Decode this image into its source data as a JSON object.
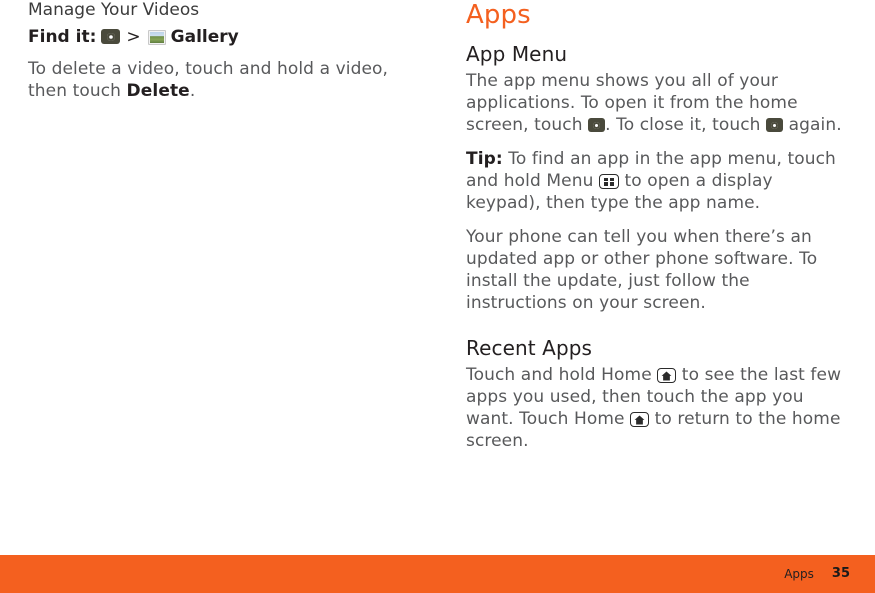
{
  "footer": {
    "section_label": "Apps",
    "page_number": "35",
    "bar_color": "#F4601F"
  },
  "accent_color": "#F4601F",
  "left_column": {
    "topic_heading": "Manage Your Videos",
    "find_it": {
      "label": "Find it:",
      "icon_1": "apps-key-icon",
      "separator": ">",
      "icon_2": "gallery-icon",
      "destination": "Gallery"
    },
    "paragraph": {
      "part_1": "To delete a video, touch and hold a video, then touch ",
      "bold": "Delete",
      "part_2": "."
    }
  },
  "right_column": {
    "section_heading": "Apps",
    "subsections": [
      {
        "heading": "App Menu",
        "paragraphs": [
          {
            "part_1": "The app menu shows you all of your applications. To open it from the home screen, touch ",
            "icon_1": "apps-key-icon",
            "part_2": ". To close it, touch ",
            "icon_2": "apps-key-icon",
            "part_3": " again."
          },
          {
            "lead": "Tip:",
            "part_1": " To find an app in the app menu, touch and hold Menu ",
            "icon_1": "menu-key-icon",
            "part_2": " to open a display keypad), then type the app name."
          },
          {
            "text": "Your phone can tell you when there’s an updated app or other phone software. To install the update, just follow the instructions on your screen."
          }
        ]
      },
      {
        "heading": "Recent Apps",
        "paragraphs": [
          {
            "part_1": "Touch and hold Home ",
            "icon_1": "home-key-icon",
            "part_2": " to see the last few apps you used, then touch the app you want. Touch Home ",
            "icon_2": "home-key-icon",
            "part_3": " to  return to the home screen."
          }
        ]
      }
    ]
  }
}
